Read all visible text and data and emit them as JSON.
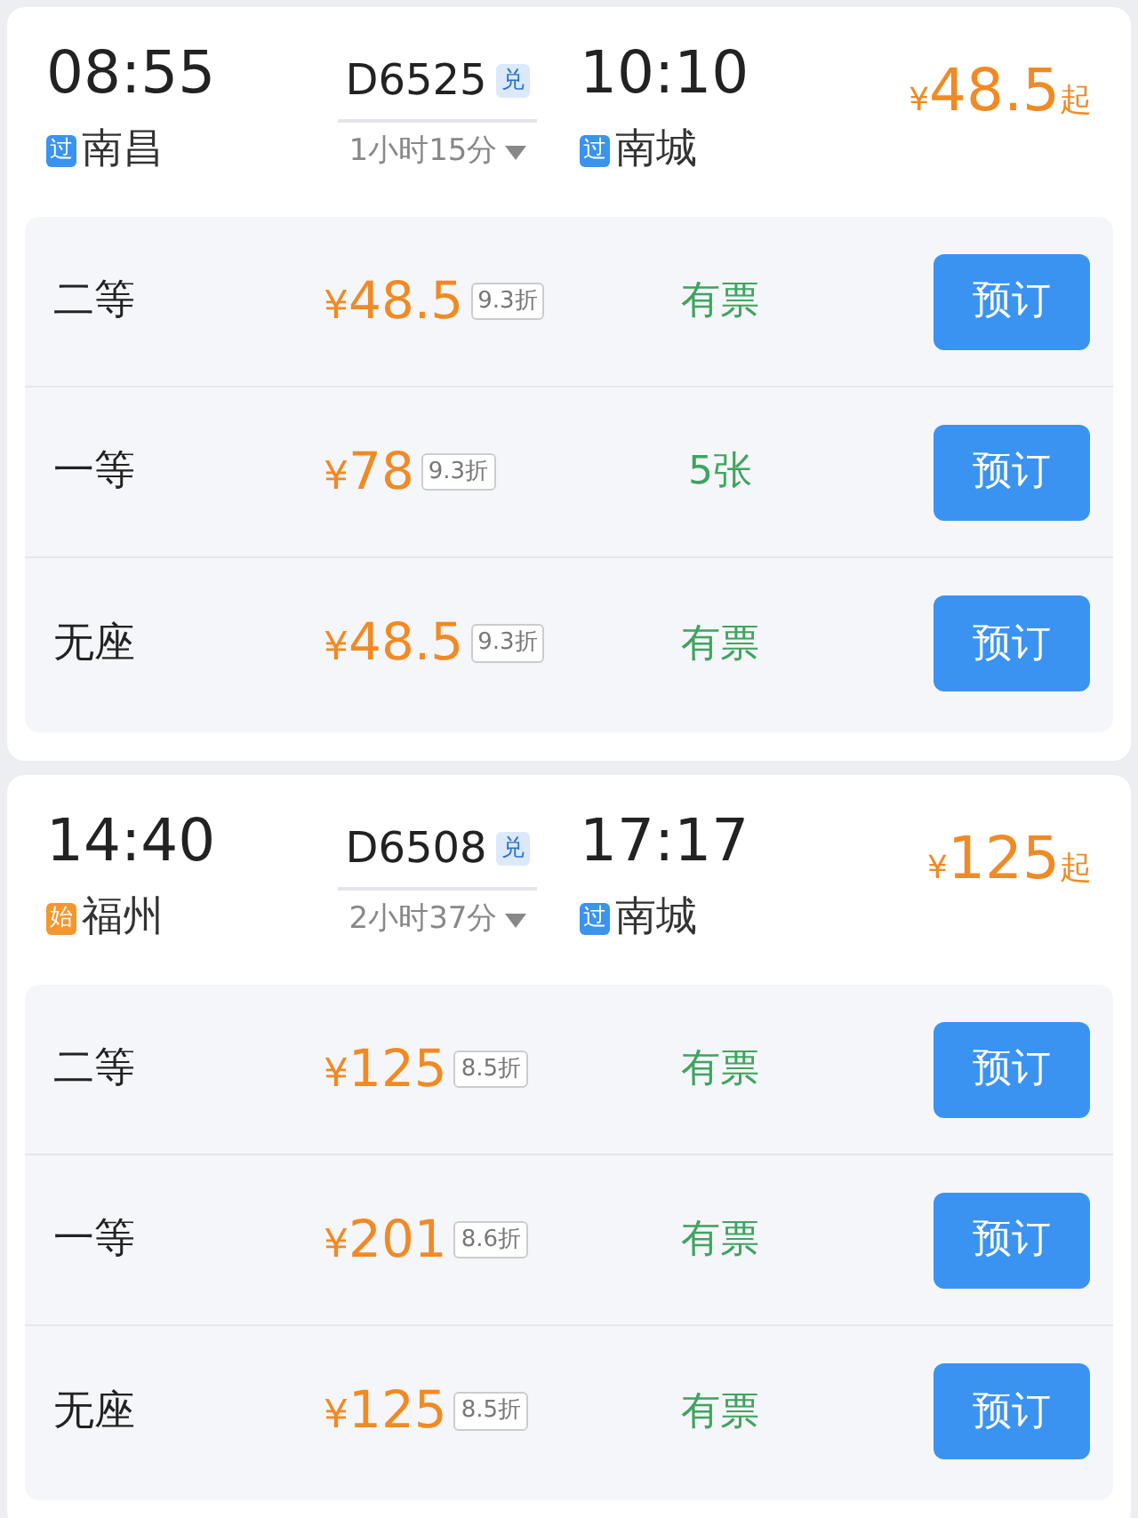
{
  "trains": [
    {
      "depart_time": "08:55",
      "depart_station": {
        "tag": "过",
        "kind": "pass",
        "name": "南昌"
      },
      "train_no": "D6525",
      "badge": "兑",
      "duration": "1小时15分",
      "arrive_time": "10:10",
      "arrive_station": {
        "tag": "过",
        "kind": "pass",
        "name": "南城"
      },
      "price": {
        "currency": "¥",
        "amount": "48.5",
        "suffix": "起"
      },
      "seats": [
        {
          "class": "二等",
          "currency": "¥",
          "price": "48.5",
          "discount": "9.3折",
          "availability": "有票",
          "button": "预订"
        },
        {
          "class": "一等",
          "currency": "¥",
          "price": "78",
          "discount": "9.3折",
          "availability": "5张",
          "button": "预订"
        },
        {
          "class": "无座",
          "currency": "¥",
          "price": "48.5",
          "discount": "9.3折",
          "availability": "有票",
          "button": "预订"
        }
      ]
    },
    {
      "depart_time": "14:40",
      "depart_station": {
        "tag": "始",
        "kind": "start",
        "name": "福州"
      },
      "train_no": "D6508",
      "badge": "兑",
      "duration": "2小时37分",
      "arrive_time": "17:17",
      "arrive_station": {
        "tag": "过",
        "kind": "pass",
        "name": "南城"
      },
      "price": {
        "currency": "¥",
        "amount": "125",
        "suffix": "起"
      },
      "seats": [
        {
          "class": "二等",
          "currency": "¥",
          "price": "125",
          "discount": "8.5折",
          "availability": "有票",
          "button": "预订"
        },
        {
          "class": "一等",
          "currency": "¥",
          "price": "201",
          "discount": "8.6折",
          "availability": "有票",
          "button": "预订"
        },
        {
          "class": "无座",
          "currency": "¥",
          "price": "125",
          "discount": "8.5折",
          "availability": "有票",
          "button": "预订"
        }
      ]
    }
  ]
}
